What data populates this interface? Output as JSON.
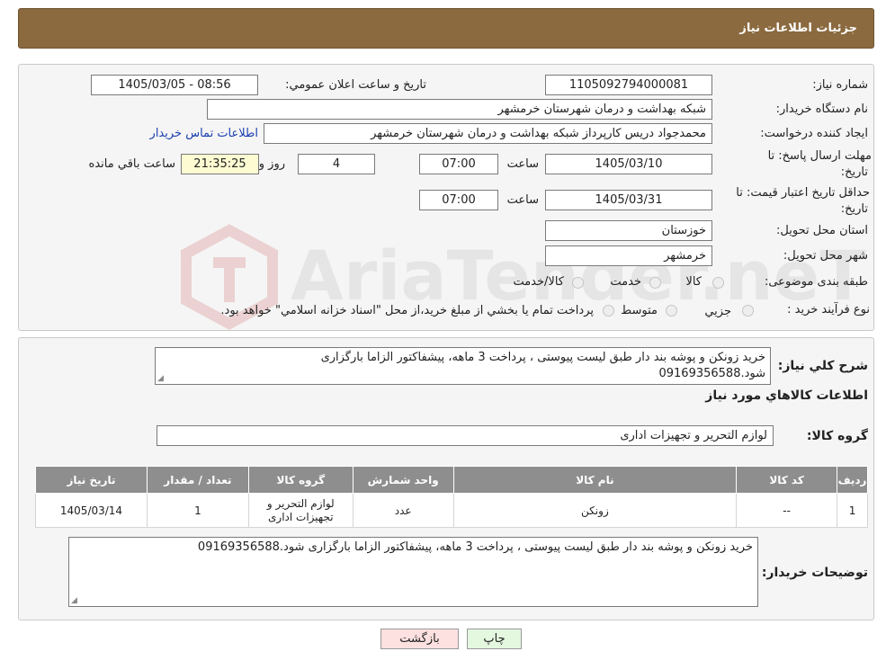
{
  "header": {
    "title": "جزئیات اطلاعات نیاز"
  },
  "form": {
    "need_number_label": "شماره نياز:",
    "need_number": "1105092794000081",
    "announce_label": "تاريخ و ساعت اعلان عمومي:",
    "announce_value": "1405/03/05 - 08:56",
    "buyer_org_label": "نام دستگاه خريدار:",
    "buyer_org": "شبکه بهداشت و درمان شهرستان خرمشهر",
    "creator_label": "ايجاد کننده درخواست:",
    "creator": "محمدجواد دريس کارپرداز شبکه بهداشت و درمان شهرستان خرمشهر",
    "contact_link": "اطلاعات تماس خريدار",
    "deadline_label_1": "مهلت ارسال پاسخ: تا",
    "deadline_label_2": "تاريخ:",
    "deadline_date": "1405/03/10",
    "time_label": "ساعت",
    "deadline_time": "07:00",
    "days_value": "4",
    "days_label": "روز و",
    "remaining_time": "21:35:25",
    "remaining_label": "ساعت باقي مانده",
    "validity_label_1": "حداقل تاريخ اعتبار قيمت: تا",
    "validity_label_2": "تاريخ:",
    "validity_date": "1405/03/31",
    "validity_time": "07:00",
    "province_label": "استان محل تحويل:",
    "province": "خوزستان",
    "city_label": "شهر محل تحويل:",
    "city": "خرمشهر",
    "category_label": "طبقه بندی موضوعی:",
    "category_options": [
      "کالا",
      "خدمت",
      "کالا/خدمت"
    ],
    "process_label": "نوع فرآيند خريد :",
    "process_options": [
      "جزيي",
      "متوسط"
    ],
    "process_note": "پرداخت تمام يا بخشي از مبلغ خريد،از محل \"اسناد خزانه اسلامي\" خواهد بود."
  },
  "details": {
    "desc_label": "شرح کلي نياز:",
    "desc_line1": "خريد زونکن و پوشه بند دار طبق ليست پيوستی ، پرداخت 3 ماهه، پيشفاکتور الزاما بارگزاری",
    "desc_line2": "شود.09169356588",
    "goods_info_title": "اطلاعات کالاهاي مورد نياز",
    "goods_group_label": "گروه کالا:",
    "goods_group": "لوازم التحرير و تجهيزات اداری",
    "table": {
      "headers": [
        "رديف",
        "کد کالا",
        "نام کالا",
        "واحد شمارش",
        "گروه کالا",
        "تعداد / مقدار",
        "تاريخ نياز"
      ],
      "row": [
        "1",
        "--",
        "زونکن",
        "عدد",
        "لوازم التحرير و تجهيزات اداری",
        "1",
        "1405/03/14"
      ]
    },
    "buyer_notes_label": "توضيحات خريدار:",
    "buyer_notes": "خريد زونکن و پوشه بند دار طبق ليست پيوستی ، پرداخت 3 ماهه، پيشفاکتور الزاما بارگزاری شود.09169356588"
  },
  "buttons": {
    "print": "چاپ",
    "back": "بازگشت"
  },
  "watermark": {
    "text": "AriaTender.neT"
  },
  "colors": {
    "header": "#8b6a3f",
    "link": "#1a3fb0",
    "table_header": "#8e8e8e",
    "back_button": "#fde0e0",
    "print_button": "#e4f7df"
  }
}
